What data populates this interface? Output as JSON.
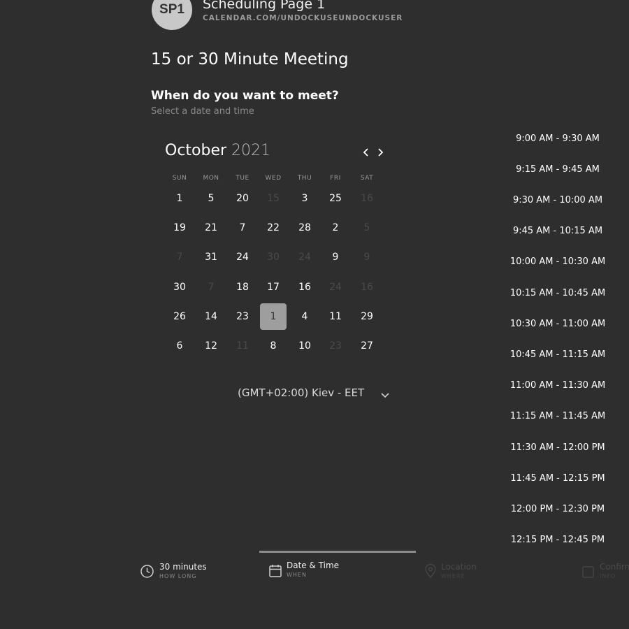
{
  "header": {
    "avatar_initials": "SP1",
    "page_title": "Scheduling Page 1",
    "page_url": "CALENDAR.COM/UNDOCKUSEUNDOCKUSER"
  },
  "meeting_title": "15 or 30 Minute Meeting",
  "question": {
    "title": "When do you want to meet?",
    "subtitle": "Select a date and time"
  },
  "calendar": {
    "month": "October",
    "year": "2021",
    "weekdays": [
      "SUN",
      "MON",
      "TUE",
      "WED",
      "THU",
      "FRI",
      "SAT"
    ],
    "weeks": [
      [
        {
          "d": "1"
        },
        {
          "d": "5"
        },
        {
          "d": "20"
        },
        {
          "d": "15",
          "disabled": true
        },
        {
          "d": "3"
        },
        {
          "d": "25"
        },
        {
          "d": "16",
          "disabled": true
        }
      ],
      [
        {
          "d": "19"
        },
        {
          "d": "21"
        },
        {
          "d": "7"
        },
        {
          "d": "22"
        },
        {
          "d": "28"
        },
        {
          "d": "2"
        },
        {
          "d": "5",
          "disabled": true
        }
      ],
      [
        {
          "d": "7",
          "disabled": true
        },
        {
          "d": "31"
        },
        {
          "d": "24"
        },
        {
          "d": "30",
          "disabled": true
        },
        {
          "d": "24",
          "disabled": true
        },
        {
          "d": "9"
        },
        {
          "d": "9",
          "disabled": true
        }
      ],
      [
        {
          "d": "30"
        },
        {
          "d": "7",
          "disabled": true
        },
        {
          "d": "18"
        },
        {
          "d": "17"
        },
        {
          "d": "16"
        },
        {
          "d": "24",
          "disabled": true
        },
        {
          "d": "16",
          "disabled": true
        }
      ],
      [
        {
          "d": "26"
        },
        {
          "d": "14"
        },
        {
          "d": "23"
        },
        {
          "d": "1",
          "selected": true
        },
        {
          "d": "4"
        },
        {
          "d": "11"
        },
        {
          "d": "29"
        }
      ],
      [
        {
          "d": "6"
        },
        {
          "d": "12"
        },
        {
          "d": "11",
          "disabled": true
        },
        {
          "d": "8"
        },
        {
          "d": "10"
        },
        {
          "d": "23",
          "disabled": true
        },
        {
          "d": "27"
        }
      ]
    ],
    "timezone": "(GMT+02:00) Kiev - EET"
  },
  "time_slots": [
    "9:00 AM - 9:30 AM",
    "9:15 AM - 9:45 AM",
    "9:30 AM - 10:00 AM",
    "9:45 AM - 10:15 AM",
    "10:00 AM - 10:30 AM",
    "10:15 AM - 10:45 AM",
    "10:30 AM - 11:00 AM",
    "10:45 AM - 11:15 AM",
    "11:00 AM - 11:30 AM",
    "11:15 AM - 11:45 AM",
    "11:30 AM - 12:00 PM",
    "11:45 AM - 12:15 PM",
    "12:00 PM - 12:30 PM",
    "12:15 PM - 12:45 PM"
  ],
  "steps": [
    {
      "label": "30 minutes",
      "sub": "HOW LONG",
      "icon": "clock-icon",
      "state": "done"
    },
    {
      "label": "Date & Time",
      "sub": "WHEN",
      "icon": "calendar-icon",
      "state": "active"
    },
    {
      "label": "Location",
      "sub": "WHERE",
      "icon": "location-pin-icon",
      "state": "pending"
    },
    {
      "label": "Confirm",
      "sub": "INFO",
      "icon": "confirm-icon",
      "state": "pending"
    }
  ]
}
